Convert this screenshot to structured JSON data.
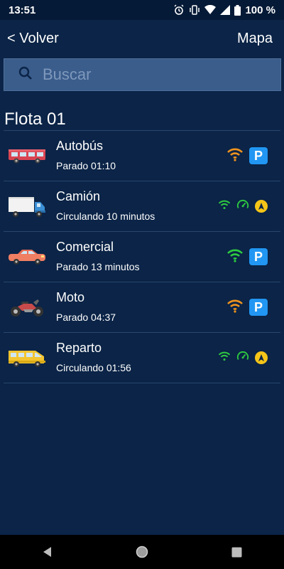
{
  "status_bar": {
    "time": "13:51",
    "battery": "100 %"
  },
  "header": {
    "back_label": "< Volver",
    "map_label": "Mapa"
  },
  "search": {
    "placeholder": "Buscar"
  },
  "fleet": {
    "title": "Flota 01",
    "vehicles": [
      {
        "name": "Autobús",
        "status": "Parado 01:10",
        "icon": "bus-icon",
        "badges": [
          "wifi-orange",
          "parking"
        ]
      },
      {
        "name": "Camión",
        "status": "Circulando 10 minutos",
        "icon": "truck-icon",
        "badges": [
          "wifi-green",
          "speedometer",
          "navigation"
        ]
      },
      {
        "name": "Comercial",
        "status": "Parado 13 minutos",
        "icon": "car-icon",
        "badges": [
          "wifi-green",
          "parking"
        ]
      },
      {
        "name": "Moto",
        "status": "Parado 04:37",
        "icon": "motorcycle-icon",
        "badges": [
          "wifi-orange",
          "parking"
        ]
      },
      {
        "name": "Reparto",
        "status": "Circulando 01:56",
        "icon": "van-icon",
        "badges": [
          "wifi-green",
          "speedometer",
          "navigation"
        ]
      }
    ]
  },
  "colors": {
    "background": "#0b2447",
    "wifi_orange": "#f0931e",
    "wifi_green": "#2ecc40",
    "parking": "#2196f3",
    "navigation": "#f5c518"
  }
}
